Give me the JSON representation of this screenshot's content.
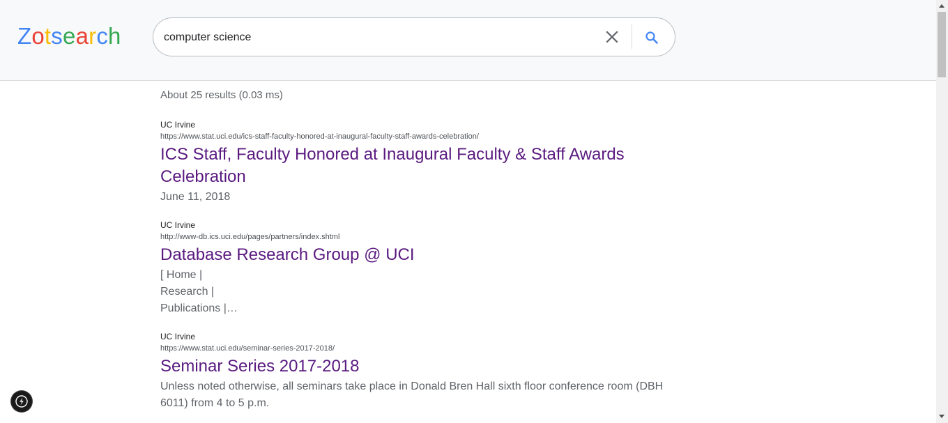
{
  "app": {
    "logo_letters": [
      {
        "char": "Z",
        "color": "#4285f4"
      },
      {
        "char": "o",
        "color": "#ea4335"
      },
      {
        "char": "t",
        "color": "#fbbc05"
      },
      {
        "char": "s",
        "color": "#4285f4"
      },
      {
        "char": "e",
        "color": "#34a853"
      },
      {
        "char": "a",
        "color": "#ea4335"
      },
      {
        "char": "r",
        "color": "#fbbc05"
      },
      {
        "char": "c",
        "color": "#4285f4"
      },
      {
        "char": "h",
        "color": "#34a853"
      }
    ]
  },
  "search": {
    "query": "computer science",
    "clear_icon": "close-icon",
    "search_icon": "search-icon",
    "accent_color": "#4285f4"
  },
  "stats": "About 25 results (0.03 ms)",
  "results": [
    {
      "site": "UC Irvine",
      "url": "https://www.stat.uci.edu/ics-staff-faculty-honored-at-inaugural-faculty-staff-awards-celebration/",
      "title": "ICS Staff, Faculty Honored at Inaugural Faculty & Staff Awards Celebration",
      "snippet_lines": [
        "June 11, 2018"
      ]
    },
    {
      "site": "UC Irvine",
      "url": "http://www-db.ics.uci.edu/pages/partners/index.shtml",
      "title": "Database Research Group @ UCI",
      "snippet_lines": [
        "[ Home |",
        "Research |",
        "Publications |…"
      ]
    },
    {
      "site": "UC Irvine",
      "url": "https://www.stat.uci.edu/seminar-series-2017-2018/",
      "title": "Seminar Series 2017-2018",
      "snippet_lines": [
        "Unless noted otherwise, all seminars take place in Donald Bren Hall sixth floor conference room (DBH 6011) from 4 to 5 p.m."
      ]
    }
  ],
  "title_color": "#5a1a80",
  "dev_badge_icon": "lightning-icon"
}
